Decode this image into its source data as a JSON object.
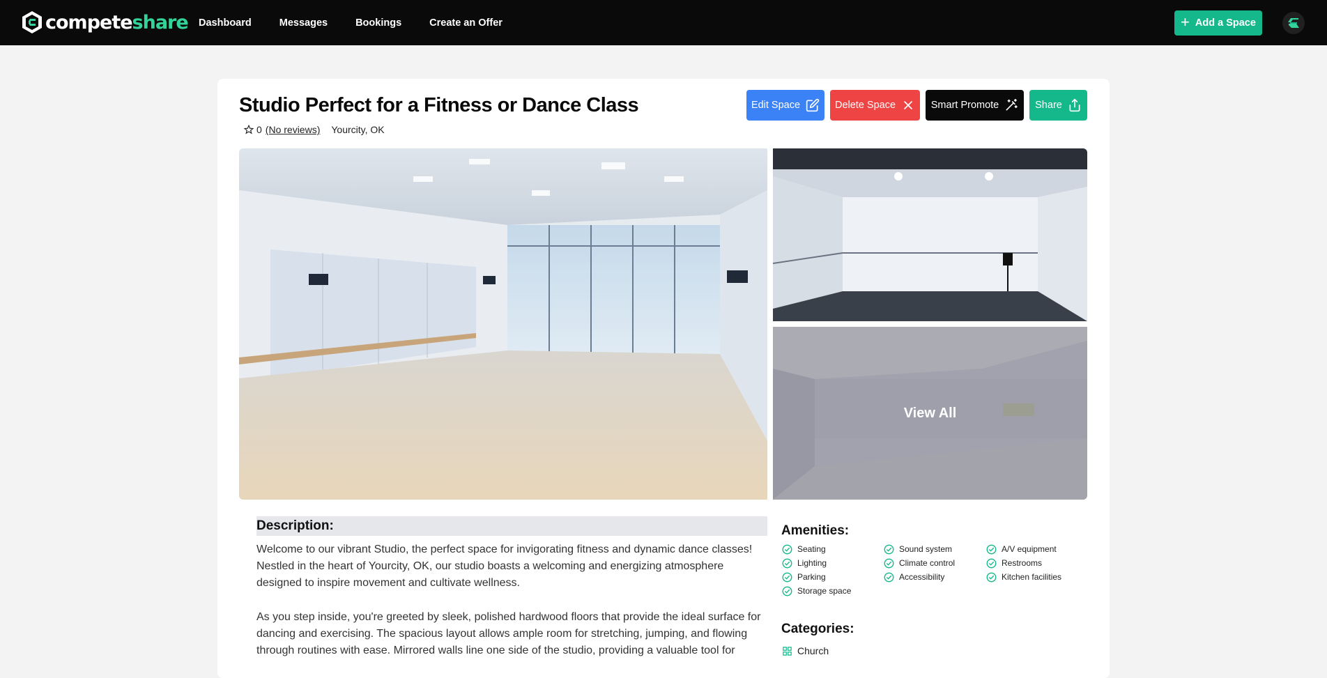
{
  "nav": {
    "brand_first": "compete",
    "brand_second": "share",
    "links": [
      "Dashboard",
      "Messages",
      "Bookings",
      "Create an Offer"
    ],
    "add_space_label": "Add a Space",
    "brand_color": "#14b88a"
  },
  "listing": {
    "title": "Studio Perfect for a Fitness or Dance Class",
    "rating": "0",
    "reviews_label": "(No reviews)",
    "location": "Yourcity, OK"
  },
  "actions": {
    "edit": "Edit Space",
    "delete": "Delete Space",
    "promote": "Smart Promote",
    "share": "Share"
  },
  "gallery": {
    "view_all": "View All"
  },
  "description": {
    "heading": "Description:",
    "paragraph1": "Welcome to our vibrant Studio, the perfect space for invigorating fitness and dynamic dance classes! Nestled in the heart of Yourcity, OK, our studio boasts a welcoming and energizing atmosphere designed to inspire movement and cultivate wellness.",
    "paragraph2": "As you step inside, you're greeted by sleek, polished hardwood floors that provide the ideal surface for dancing and exercising. The spacious layout allows ample room for stretching, jumping, and flowing through routines with ease. Mirrored walls line one side of the studio, providing a valuable tool for"
  },
  "amenities": {
    "heading": "Amenities:",
    "items": [
      "Seating",
      "Sound system",
      "A/V equipment",
      "Lighting",
      "Climate control",
      "Restrooms",
      "Parking",
      "Accessibility",
      "Kitchen facilities",
      "Storage space"
    ]
  },
  "categories": {
    "heading": "Categories:",
    "items": [
      "Church"
    ]
  }
}
